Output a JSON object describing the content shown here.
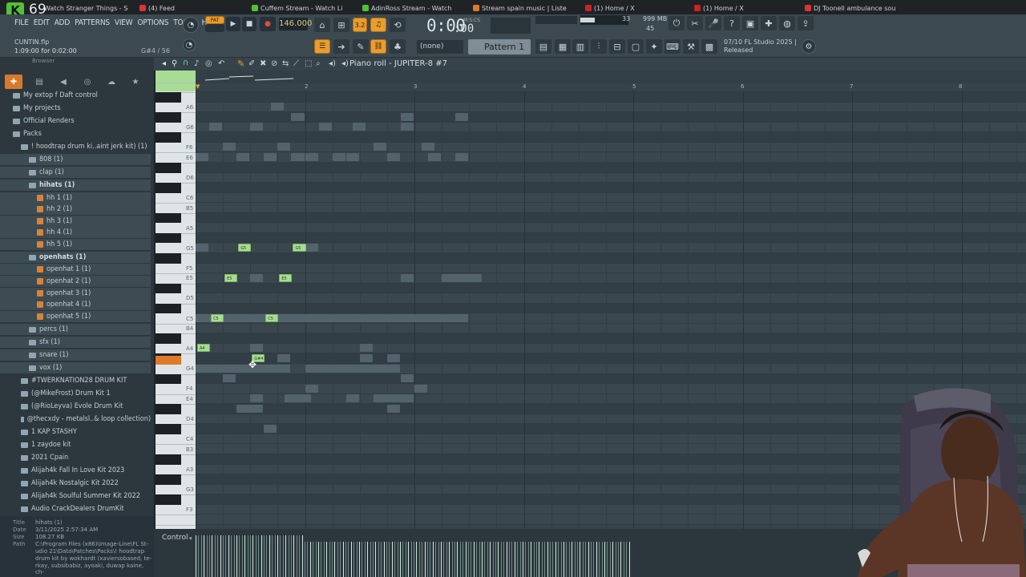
{
  "tabs": [
    {
      "label": "Watch Stranger Things - Se"
    },
    {
      "label": "(4) Feed"
    },
    {
      "label": "Cuffem Stream - Watch Li"
    },
    {
      "label": "AdinRoss Stream - Watch"
    },
    {
      "label": "Stream spain music | Liste"
    },
    {
      "label": "(1) Home / X"
    },
    {
      "label": "(1) Home / X"
    },
    {
      "label": "DJ Toonell ambulance sou"
    }
  ],
  "logo_num": "69",
  "menu": [
    "FILE",
    "EDIT",
    "ADD",
    "PATTERNS",
    "VIEW",
    "OPTIONS",
    "TOOLS",
    "HELP"
  ],
  "hint": {
    "file": "CUNTIN.flp",
    "time": "1:09:00 for 0:02:00",
    "pos": "G#4 / 56"
  },
  "transport": {
    "pat": "PAT",
    "bpm": "146.000",
    "time": "0:00",
    "time_small": ":00",
    "mcs": "M:S:CS",
    "steps": "3.2"
  },
  "meter": {
    "n1": "33",
    "n2": "999 MB",
    "n3": "45"
  },
  "selector": {
    "none": "(none)",
    "pattern": "Pattern 1"
  },
  "news": {
    "line1": "07/10 FL Studio 2025 |",
    "line2": "Released"
  },
  "browser": {
    "head": "Browser",
    "items": [
      {
        "label": "My extop f Daft control",
        "level": 0,
        "type": "folder"
      },
      {
        "label": "My projects",
        "level": 0,
        "type": "folder"
      },
      {
        "label": "Official Renders",
        "level": 0,
        "type": "folder"
      },
      {
        "label": "Packs",
        "level": 0,
        "type": "folder"
      },
      {
        "label": "! hoodtrap drum ki..aint jerk kit) (1)",
        "level": 1,
        "type": "folder"
      },
      {
        "label": "808 (1)",
        "level": 2,
        "type": "folder"
      },
      {
        "label": "clap (1)",
        "level": 2,
        "type": "folder"
      },
      {
        "label": "hihats (1)",
        "level": 2,
        "type": "folder",
        "bold": true
      },
      {
        "label": "hh 1 (1)",
        "level": 3,
        "type": "file"
      },
      {
        "label": "hh 2 (1)",
        "level": 3,
        "type": "file"
      },
      {
        "label": "hh 3 (1)",
        "level": 3,
        "type": "file"
      },
      {
        "label": "hh 4 (1)",
        "level": 3,
        "type": "file"
      },
      {
        "label": "hh 5 (1)",
        "level": 3,
        "type": "file"
      },
      {
        "label": "openhats (1)",
        "level": 2,
        "type": "folder",
        "bold": true
      },
      {
        "label": "openhat 1 (1)",
        "level": 3,
        "type": "file"
      },
      {
        "label": "openhat 2 (1)",
        "level": 3,
        "type": "file"
      },
      {
        "label": "openhat 3 (1)",
        "level": 3,
        "type": "file"
      },
      {
        "label": "openhat 4 (1)",
        "level": 3,
        "type": "file"
      },
      {
        "label": "openhat 5 (1)",
        "level": 3,
        "type": "file"
      },
      {
        "label": "percs (1)",
        "level": 2,
        "type": "folder"
      },
      {
        "label": "sfx (1)",
        "level": 2,
        "type": "folder"
      },
      {
        "label": "snare (1)",
        "level": 2,
        "type": "folder"
      },
      {
        "label": "vox (1)",
        "level": 2,
        "type": "folder"
      },
      {
        "label": "#TWERKNATION28 DRUM KIT",
        "level": 1,
        "type": "folder"
      },
      {
        "label": "(@MikeFrost) Drum Kit 1",
        "level": 1,
        "type": "folder"
      },
      {
        "label": "(@RioLeyva) Evole Drum Kit",
        "level": 1,
        "type": "folder"
      },
      {
        "label": "@thecxdy - metalsl..& loop collection)",
        "level": 1,
        "type": "folder"
      },
      {
        "label": "1 KAP STASHY",
        "level": 1,
        "type": "folder"
      },
      {
        "label": "1 zaydoe kit",
        "level": 1,
        "type": "folder"
      },
      {
        "label": "2021 Cpain",
        "level": 1,
        "type": "folder"
      },
      {
        "label": "Alijah4k Fall In Love Kit 2023",
        "level": 1,
        "type": "folder"
      },
      {
        "label": "Alijah4k Nostalgic Kit 2022",
        "level": 1,
        "type": "folder"
      },
      {
        "label": "Alijah4k Soulful Summer Kit 2022",
        "level": 1,
        "type": "folder"
      },
      {
        "label": "Audio CrackDealers DrumKit",
        "level": 1,
        "type": "folder"
      }
    ],
    "info": [
      {
        "k": "Title",
        "v": "hihats (1)"
      },
      {
        "k": "Date",
        "v": "3/11/2025 2:57:34 AM"
      },
      {
        "k": "Size",
        "v": "108.27 KB"
      },
      {
        "k": "Path",
        "v": "C:\\Program Files (x86)\\Image-Line\\FL St-"
      },
      {
        "k": "",
        "v": "udio 21\\Data\\Patches\\Packs\\! hoodtrap"
      },
      {
        "k": "",
        "v": "drum kit by wokhardt (xaviersobased, te-"
      },
      {
        "k": "",
        "v": "rkay, subsibabiz, ayoaki, duwap kaine, ch-"
      }
    ]
  },
  "piano_roll": {
    "title": "Piano roll - JUPITER-8 #7",
    "ruler": [
      "2",
      "3",
      "4",
      "5",
      "6",
      "7",
      "8"
    ],
    "key_labels": [
      "A6",
      "G6",
      "F6",
      "E6",
      "D6",
      "C6",
      "B5",
      "A5",
      "G5",
      "F5",
      "E5",
      "D5",
      "C5",
      "B4",
      "A4",
      "G4",
      "F4",
      "E4",
      "D4",
      "C4",
      "B3",
      "A3",
      "G3",
      "F3"
    ],
    "green_notes": [
      "G5",
      "G5",
      "E5",
      "E5",
      "C5",
      "C5",
      "A4",
      "G#4"
    ],
    "control_label": "Control"
  },
  "colors": {
    "accent_orange": "#e89d2f",
    "note_green": "#a8dc94",
    "bg": "#36434a"
  }
}
